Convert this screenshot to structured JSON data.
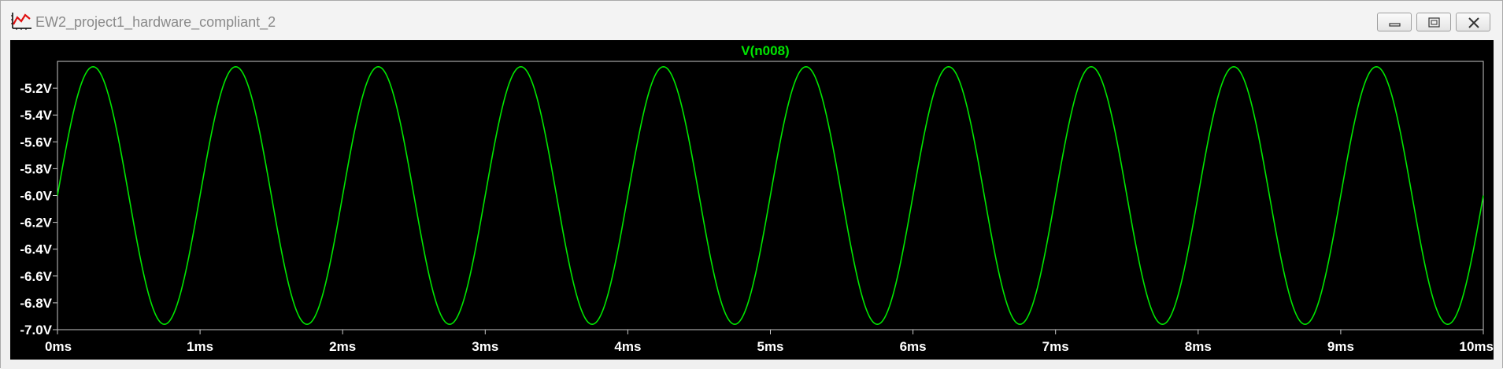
{
  "window": {
    "title": "EW2_project1_hardware_compliant_2",
    "buttons": [
      "minimize",
      "restore",
      "close"
    ]
  },
  "colors": {
    "background": "#000000",
    "trace": "#00e600",
    "axis": "#c8c8c8",
    "label": "#ffffff"
  },
  "chart_data": {
    "type": "line",
    "title": "V(n008)",
    "xlabel": "",
    "ylabel": "",
    "xlim": [
      0,
      10
    ],
    "ylim": [
      -7.0,
      -5.0
    ],
    "x_unit": "ms",
    "y_unit": "V",
    "x_ticks": [
      "0ms",
      "1ms",
      "2ms",
      "3ms",
      "4ms",
      "5ms",
      "6ms",
      "7ms",
      "8ms",
      "9ms",
      "10ms"
    ],
    "y_ticks": [
      "-5.2V",
      "-5.4V",
      "-5.6V",
      "-5.8V",
      "-6.0V",
      "-6.2V",
      "-6.4V",
      "-6.6V",
      "-6.8V",
      "-7.0V"
    ],
    "grid": false,
    "series": [
      {
        "name": "V(n008)",
        "waveform": "sine",
        "frequency_hz": 1000,
        "offset_v": -6.0,
        "amplitude_v": 0.96,
        "phase_deg": 0,
        "x_range_ms": [
          0,
          10
        ]
      }
    ]
  }
}
